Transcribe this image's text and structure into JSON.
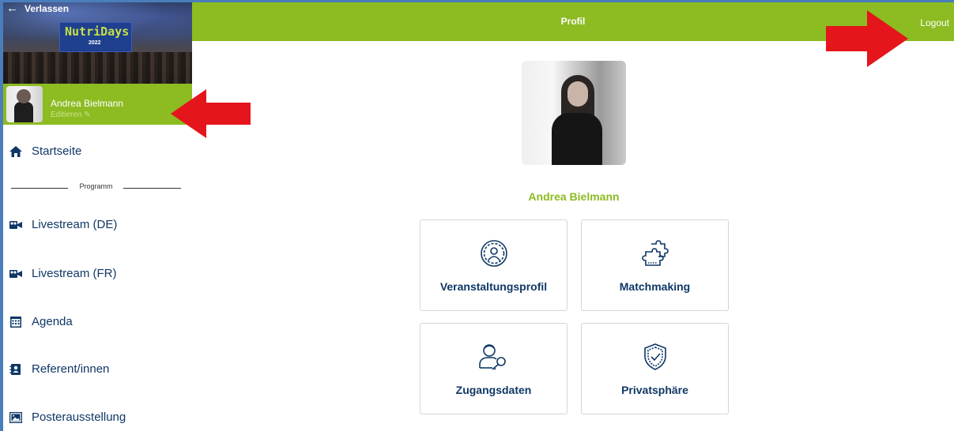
{
  "sidebar": {
    "back_label": "Verlassen",
    "banner": {
      "logo_text": "NutriDays",
      "logo_year": "2022"
    },
    "user": {
      "name": "Andrea Bielmann",
      "edit_label": "Editieren"
    },
    "items": [
      {
        "label": "Startseite",
        "icon": "home-icon"
      },
      {
        "label": "Livestream (DE)",
        "icon": "video-camera-icon"
      },
      {
        "label": "Livestream (FR)",
        "icon": "video-camera-icon"
      },
      {
        "label": "Agenda",
        "icon": "calendar-icon"
      },
      {
        "label": "Referent/innen",
        "icon": "address-book-icon"
      },
      {
        "label": "Posterausstellung",
        "icon": "image-icon"
      }
    ],
    "section_label": "Programm"
  },
  "header": {
    "title": "Profil",
    "logout_label": "Logout"
  },
  "main": {
    "profile_name": "Andrea Bielmann",
    "tiles": [
      {
        "label": "Veranstaltungsprofil",
        "icon": "user-circle-icon"
      },
      {
        "label": "Matchmaking",
        "icon": "puzzle-icon"
      },
      {
        "label": "Zugangsdaten",
        "icon": "user-key-icon"
      },
      {
        "label": "Privatsphäre",
        "icon": "shield-check-icon"
      }
    ]
  },
  "colors": {
    "accent_green": "#8dbb22",
    "nav_text": "#0f3766",
    "annotation_red": "#e4151b"
  }
}
